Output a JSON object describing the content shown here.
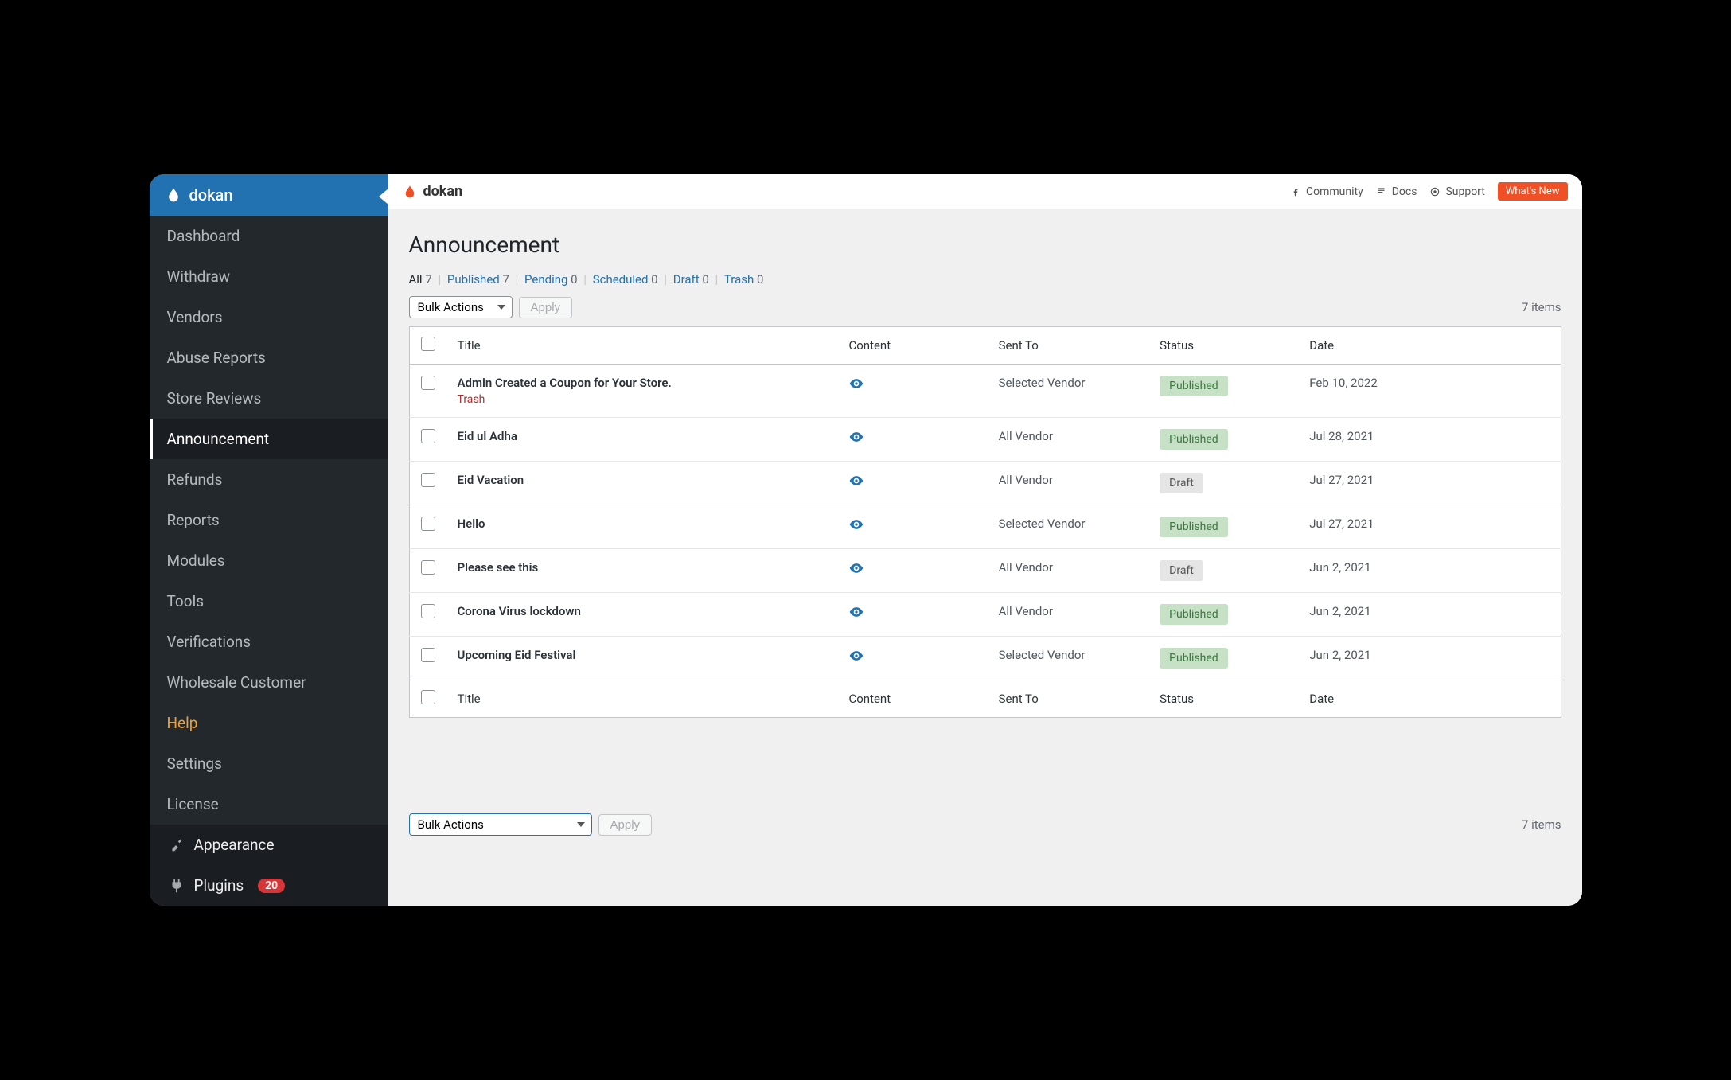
{
  "brand": "dokan",
  "sidebar": {
    "items": [
      {
        "label": "Dashboard",
        "active": false
      },
      {
        "label": "Withdraw",
        "active": false
      },
      {
        "label": "Vendors",
        "active": false
      },
      {
        "label": "Abuse Reports",
        "active": false
      },
      {
        "label": "Store Reviews",
        "active": false
      },
      {
        "label": "Announcement",
        "active": true
      },
      {
        "label": "Refunds",
        "active": false
      },
      {
        "label": "Reports",
        "active": false
      },
      {
        "label": "Modules",
        "active": false
      },
      {
        "label": "Tools",
        "active": false
      },
      {
        "label": "Verifications",
        "active": false
      },
      {
        "label": "Wholesale Customer",
        "active": false
      },
      {
        "label": "Help",
        "active": false,
        "highlight": true
      },
      {
        "label": "Settings",
        "active": false
      },
      {
        "label": "License",
        "active": false
      }
    ],
    "appearance": "Appearance",
    "plugins": "Plugins",
    "plugins_badge": "20"
  },
  "topbar": {
    "community": "Community",
    "docs": "Docs",
    "support": "Support",
    "whatsnew": "What's New"
  },
  "page": {
    "title": "Announcement",
    "filters": [
      {
        "label": "All",
        "count": "7",
        "active": true
      },
      {
        "label": "Published",
        "count": "7"
      },
      {
        "label": "Pending",
        "count": "0"
      },
      {
        "label": "Scheduled",
        "count": "0"
      },
      {
        "label": "Draft",
        "count": "0"
      },
      {
        "label": "Trash",
        "count": "0"
      }
    ],
    "bulk_actions_label": "Bulk Actions",
    "apply_label": "Apply",
    "items_count": "7 items",
    "columns": {
      "title": "Title",
      "content": "Content",
      "sent_to": "Sent To",
      "status": "Status",
      "date": "Date"
    },
    "rows": [
      {
        "title": "Admin Created a Coupon for Your Store.",
        "trash": "Trash",
        "sent_to": "Selected Vendor",
        "status": "Published",
        "date": "Feb 10, 2022"
      },
      {
        "title": "Eid ul Adha",
        "sent_to": "All Vendor",
        "status": "Published",
        "date": "Jul 28, 2021"
      },
      {
        "title": "Eid Vacation",
        "sent_to": "All Vendor",
        "status": "Draft",
        "date": "Jul 27, 2021"
      },
      {
        "title": "Hello",
        "sent_to": "Selected Vendor",
        "status": "Published",
        "date": "Jul 27, 2021"
      },
      {
        "title": "Please see this",
        "sent_to": "All Vendor",
        "status": "Draft",
        "date": "Jun 2, 2021"
      },
      {
        "title": "Corona Virus lockdown",
        "sent_to": "All Vendor",
        "status": "Published",
        "date": "Jun 2, 2021"
      },
      {
        "title": "Upcoming Eid Festival",
        "sent_to": "Selected Vendor",
        "status": "Published",
        "date": "Jun 2, 2021"
      }
    ]
  }
}
